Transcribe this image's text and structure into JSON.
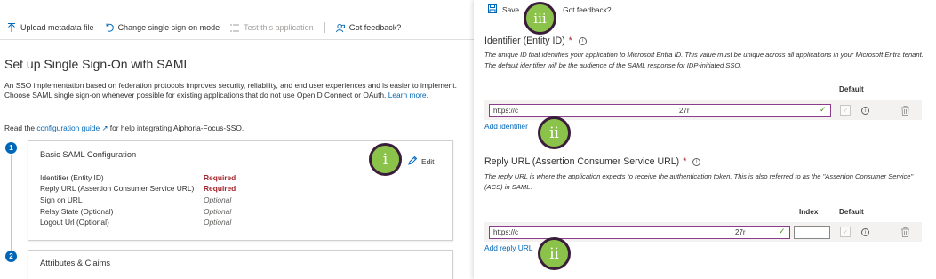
{
  "left": {
    "toolbar": {
      "upload": "Upload metadata file",
      "change_sso": "Change single sign-on mode",
      "test_app": "Test this application",
      "feedback": "Got feedback?"
    },
    "title": "Set up Single Sign-On with SAML",
    "description": "An SSO implementation based on federation protocols improves security, reliability, and end user experiences and is easier to implement. Choose SAML single sign-on whenever possible for existing applications that do not use OpenID Connect or OAuth.",
    "learn_more": "Learn more.",
    "read_prefix": "Read the",
    "config_guide": "configuration guide",
    "read_suffix": "for help integrating Aiphoria-Focus-SSO.",
    "step1": {
      "number": "1",
      "title": "Basic SAML Configuration",
      "edit": "Edit",
      "rows": [
        {
          "key": "Identifier (Entity ID)",
          "value": "Required",
          "status": "required"
        },
        {
          "key": "Reply URL (Assertion Consumer Service URL)",
          "value": "Required",
          "status": "required"
        },
        {
          "key": "Sign on URL",
          "value": "Optional",
          "status": "optional"
        },
        {
          "key": "Relay State (Optional)",
          "value": "Optional",
          "status": "optional"
        },
        {
          "key": "Logout Url (Optional)",
          "value": "Optional",
          "status": "optional"
        }
      ]
    },
    "step2": {
      "number": "2",
      "title": "Attributes & Claims"
    }
  },
  "markers": {
    "m1": "i",
    "m2": "ii",
    "m3": "iii"
  },
  "right": {
    "toolbar": {
      "save": "Save",
      "feedback": "Got feedback?"
    },
    "identifier": {
      "title": "Identifier (Entity ID)",
      "required_mark": "*",
      "description": "The unique ID that identifies your application to Microsoft Entra ID. This value must be unique across all applications in your Microsoft Entra tenant. The default identifier will be the audience of the SAML response for IDP-initiated SSO.",
      "col_default": "Default",
      "input_prefix": "https://c",
      "input_suffix": "27r",
      "add_link": "Add identifier"
    },
    "reply": {
      "title": "Reply URL (Assertion Consumer Service URL)",
      "required_mark": "*",
      "description": "The reply URL is where the application expects to receive the authentication token. This is also referred to as the \"Assertion Consumer Service\" (ACS) in SAML.",
      "col_index": "Index",
      "col_default": "Default",
      "input_prefix": "https://c",
      "input_suffix": "27r",
      "add_link": "Add reply URL"
    }
  }
}
